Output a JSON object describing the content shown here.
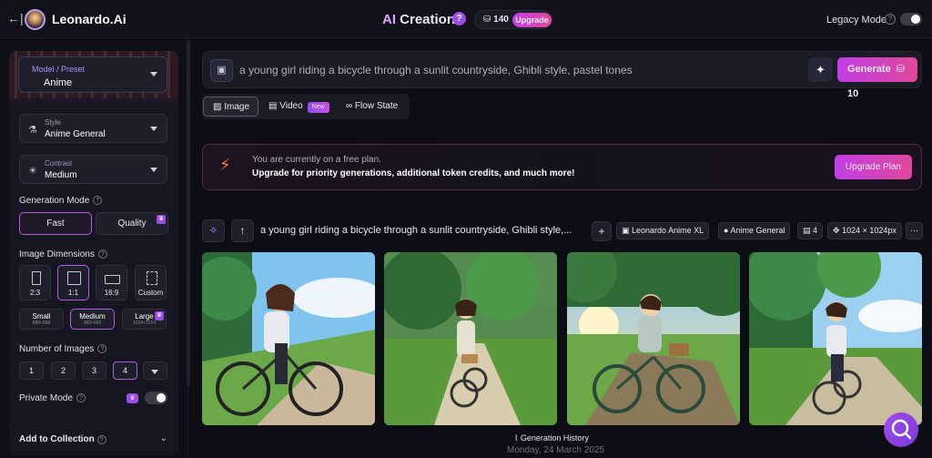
{
  "header": {
    "back_icon": "←|",
    "brand": "Leonardo.Ai",
    "title_prefix": "AI",
    "title_rest": " Creation",
    "help": "?",
    "tokens": "140",
    "upgrade": "Upgrade",
    "legacy_label": "Legacy Mode",
    "legacy_on": false
  },
  "sidebar": {
    "preset_label": "Model / Preset",
    "preset_value": "Anime",
    "style_label": "Style",
    "style_value": "Anime General",
    "contrast_label": "Contrast",
    "contrast_value": "Medium",
    "gen_mode_label": "Generation Mode",
    "gen_modes": [
      "Fast",
      "Quality"
    ],
    "dimensions_label": "Image Dimensions",
    "ratios": [
      "2:3",
      "1:1",
      "16:9",
      "Custom"
    ],
    "sizes": [
      {
        "name": "Small",
        "px": "888×888"
      },
      {
        "name": "Medium",
        "px": "960×960"
      },
      {
        "name": "Large",
        "px": "1024×1024"
      }
    ],
    "num_images_label": "Number of Images",
    "num_images": [
      "1",
      "2",
      "3",
      "4"
    ],
    "private_label": "Private Mode",
    "collection_label": "Add to Collection"
  },
  "prompt": {
    "text": "a young girl riding a bicycle through a sunlit countryside, Ghibli style, pastel tones",
    "generate_label": "Generate",
    "generate_cost": "10"
  },
  "tabs": {
    "image": "Image",
    "video": "Video",
    "video_badge": "New",
    "flow": "Flow State"
  },
  "banner": {
    "line1": "You are currently on a free plan.",
    "line2": "Upgrade for priority generations, additional token credits, and much more!",
    "button": "Upgrade Plan"
  },
  "generation": {
    "prompt": "a young girl riding a bicycle through a sunlit countryside, Ghibli style,...",
    "model": "Leonardo Anime XL",
    "style": "Anime General",
    "count": "4",
    "dimensions": "1024 × 1024px"
  },
  "footer": {
    "history": "Generation History",
    "date": "Monday, 24 March 2025"
  },
  "colors": {
    "accent": "#b45ee8",
    "gradient_start": "#c23ee6",
    "gradient_end": "#e0479a",
    "background": "#0d0e15"
  }
}
